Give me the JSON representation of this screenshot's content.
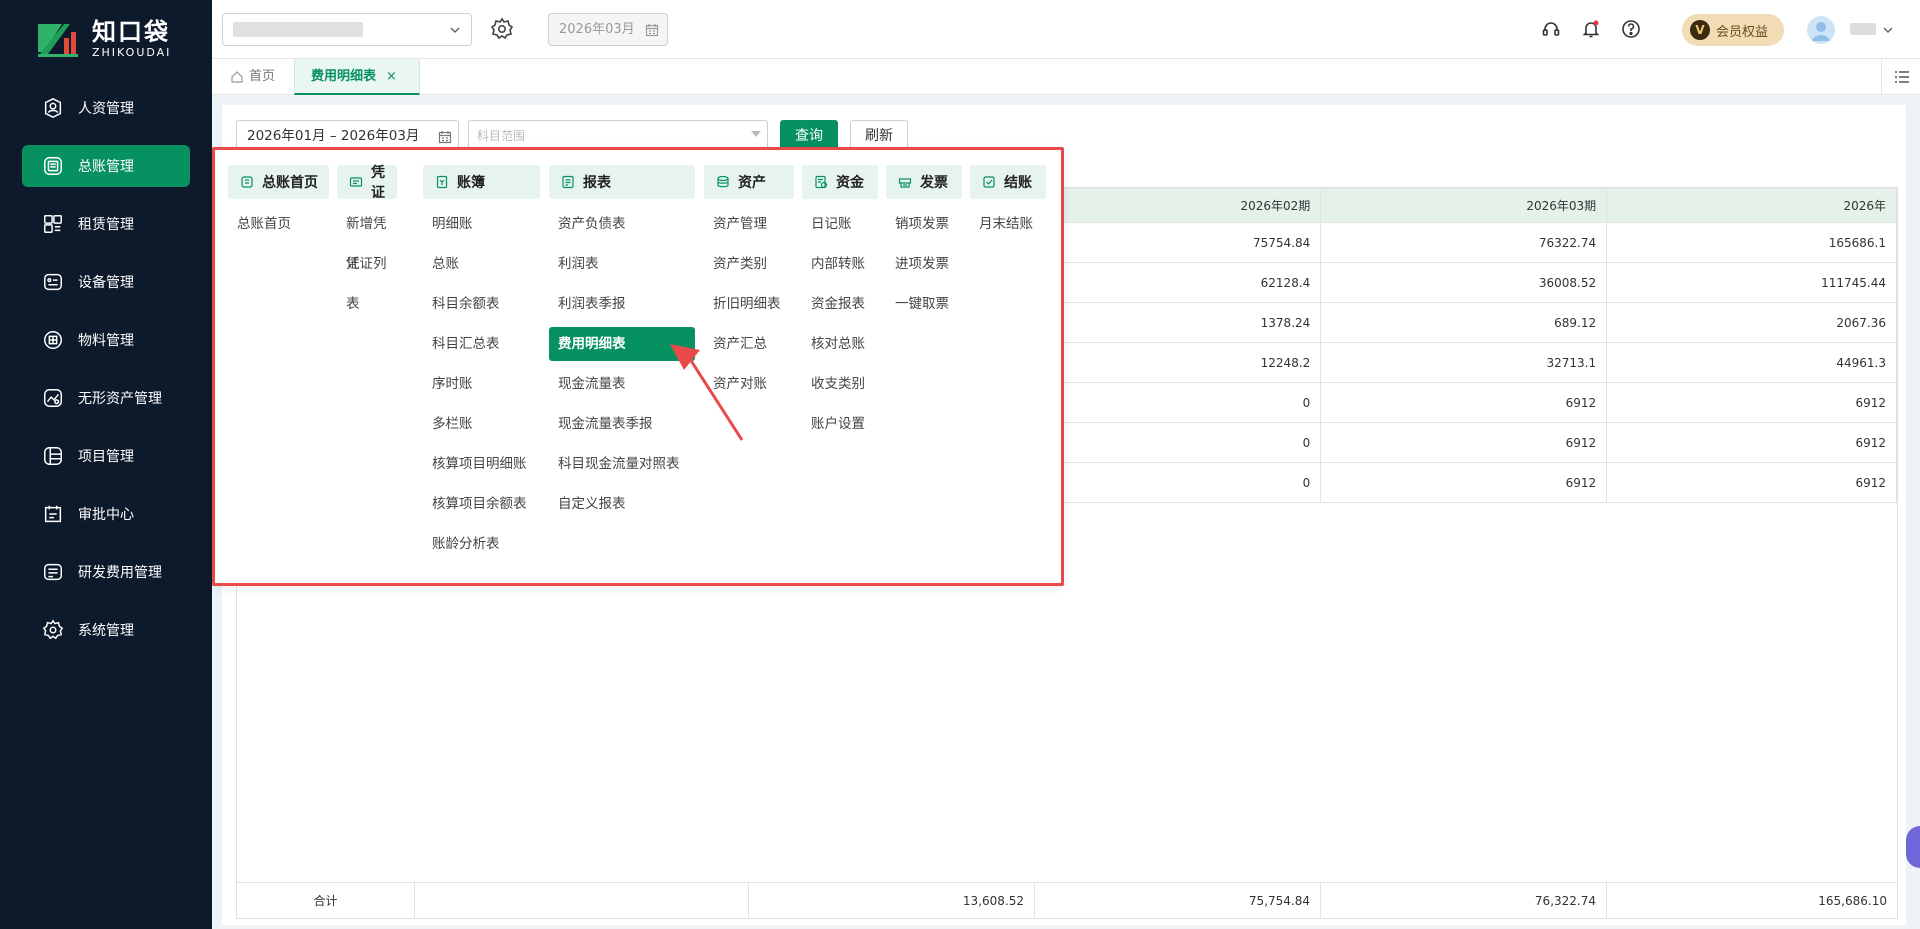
{
  "brand": {
    "name_cn": "知口袋",
    "name_en": "ZHIKOUDAI"
  },
  "sidebar": {
    "items": [
      {
        "label": "人资管理",
        "icon": "user-circle-icon"
      },
      {
        "label": "总账管理",
        "icon": "ledger-icon",
        "active": true
      },
      {
        "label": "租赁管理",
        "icon": "lease-icon"
      },
      {
        "label": "设备管理",
        "icon": "device-icon"
      },
      {
        "label": "物料管理",
        "icon": "material-icon"
      },
      {
        "label": "无形资产管理",
        "icon": "intangible-asset-icon"
      },
      {
        "label": "项目管理",
        "icon": "project-icon"
      },
      {
        "label": "审批中心",
        "icon": "approval-icon"
      },
      {
        "label": "研发费用管理",
        "icon": "rnd-icon"
      },
      {
        "label": "系统管理",
        "icon": "settings-icon"
      }
    ]
  },
  "header": {
    "period": "2026年03月",
    "vip_label": "会员权益",
    "vip_badge": "V"
  },
  "tabs": {
    "home": "首页",
    "active": "费用明细表",
    "close": "×"
  },
  "filters": {
    "date_range": "2026年01月 – 2026年03月",
    "account_placeholder": "科目范围",
    "query": "查询",
    "refresh": "刷新"
  },
  "table": {
    "headers": [
      "2026年02期",
      "2026年03期",
      "2026年"
    ],
    "rows": [
      [
        "75754.84",
        "76322.74",
        "165686.1"
      ],
      [
        "62128.4",
        "36008.52",
        "111745.44"
      ],
      [
        "1378.24",
        "689.12",
        "2067.36"
      ],
      [
        "12248.2",
        "32713.1",
        "44961.3"
      ],
      [
        "0",
        "6912",
        "6912"
      ],
      [
        "0",
        "6912",
        "6912"
      ],
      [
        "0",
        "6912",
        "6912"
      ]
    ],
    "total": {
      "label": "合计",
      "values": [
        "13,608.52",
        "75,754.84",
        "76,322.74",
        "165,686.10"
      ]
    }
  },
  "mega_menu": {
    "columns": [
      {
        "title": "总账首页",
        "items": [
          "总账首页"
        ]
      },
      {
        "title": "凭证",
        "items": [
          "新增凭证",
          "凭证列表"
        ]
      },
      {
        "title": "账簿",
        "items": [
          "明细账",
          "总账",
          "科目余额表",
          "科目汇总表",
          "序时账",
          "多栏账",
          "核算项目明细账",
          "核算项目余额表",
          "账龄分析表"
        ]
      },
      {
        "title": "报表",
        "items": [
          "资产负债表",
          "利润表",
          "利润表季报",
          "费用明细表",
          "现金流量表",
          "现金流量表季报",
          "科目现金流量对照表",
          "自定义报表"
        ]
      },
      {
        "title": "资产",
        "items": [
          "资产管理",
          "资产类别",
          "折旧明细表",
          "资产汇总",
          "资产对账"
        ]
      },
      {
        "title": "资金",
        "items": [
          "日记账",
          "内部转账",
          "资金报表",
          "核对总账",
          "收支类别",
          "账户设置"
        ]
      },
      {
        "title": "发票",
        "items": [
          "销项发票",
          "进项发票",
          "一键取票"
        ]
      },
      {
        "title": "结账",
        "items": [
          "月末结账"
        ]
      }
    ],
    "active_item": "费用明细表"
  },
  "colors": {
    "accent": "#079160",
    "sidebar_bg": "#0d1a2b",
    "highlight_border": "#e84a4a"
  }
}
